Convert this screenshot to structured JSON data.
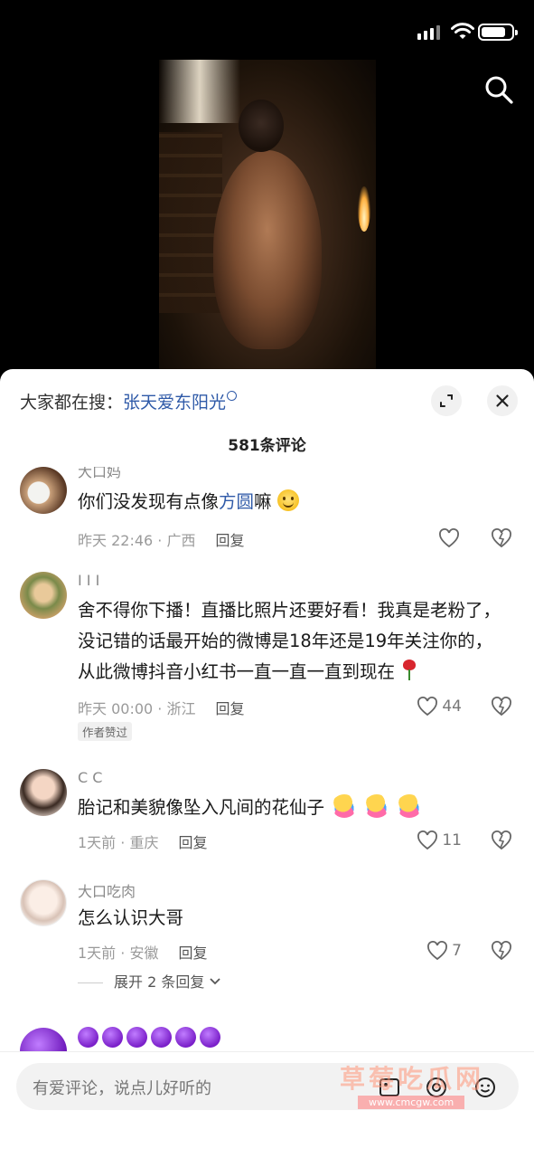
{
  "sheet": {
    "trend_prefix": "大家都在搜：",
    "trend_keyword": "张天爱东阳光",
    "count_label": "581条评论"
  },
  "comments": [
    {
      "name": "大口妈",
      "text_before": "你们没发现有点像",
      "link": "方圆",
      "text_after": "嘛",
      "time": "昨天 22:46 · 广西",
      "reply": "回复",
      "likes": ""
    },
    {
      "name": "I I I",
      "text": "舍不得你下播！直播比照片还要好看！我真是老粉了，没记错的话最开始的微博是18年还是19年关注你的，从此微博抖音小红书一直一直一直到现在",
      "time": "昨天 00:00 · 浙江",
      "reply": "回复",
      "likes": "44",
      "tag": "作者赞过"
    },
    {
      "name": "C C",
      "text": "胎记和美貌像坠入凡间的花仙子",
      "time": "1天前 · 重庆",
      "reply": "回复",
      "likes": "11"
    },
    {
      "name": "大口吃肉",
      "text": "怎么认识大哥",
      "time": "1天前 · 安徽",
      "reply": "回复",
      "likes": "7",
      "expand": "展开 2 条回复"
    }
  ],
  "input": {
    "placeholder": "有爱评论，说点儿好听的"
  },
  "watermark": {
    "text": "草莓吃瓜网",
    "url": "www.cmcgw.com"
  },
  "colors": {
    "link": "#2f5aa8",
    "background": "#000000",
    "sheet": "#ffffff"
  }
}
